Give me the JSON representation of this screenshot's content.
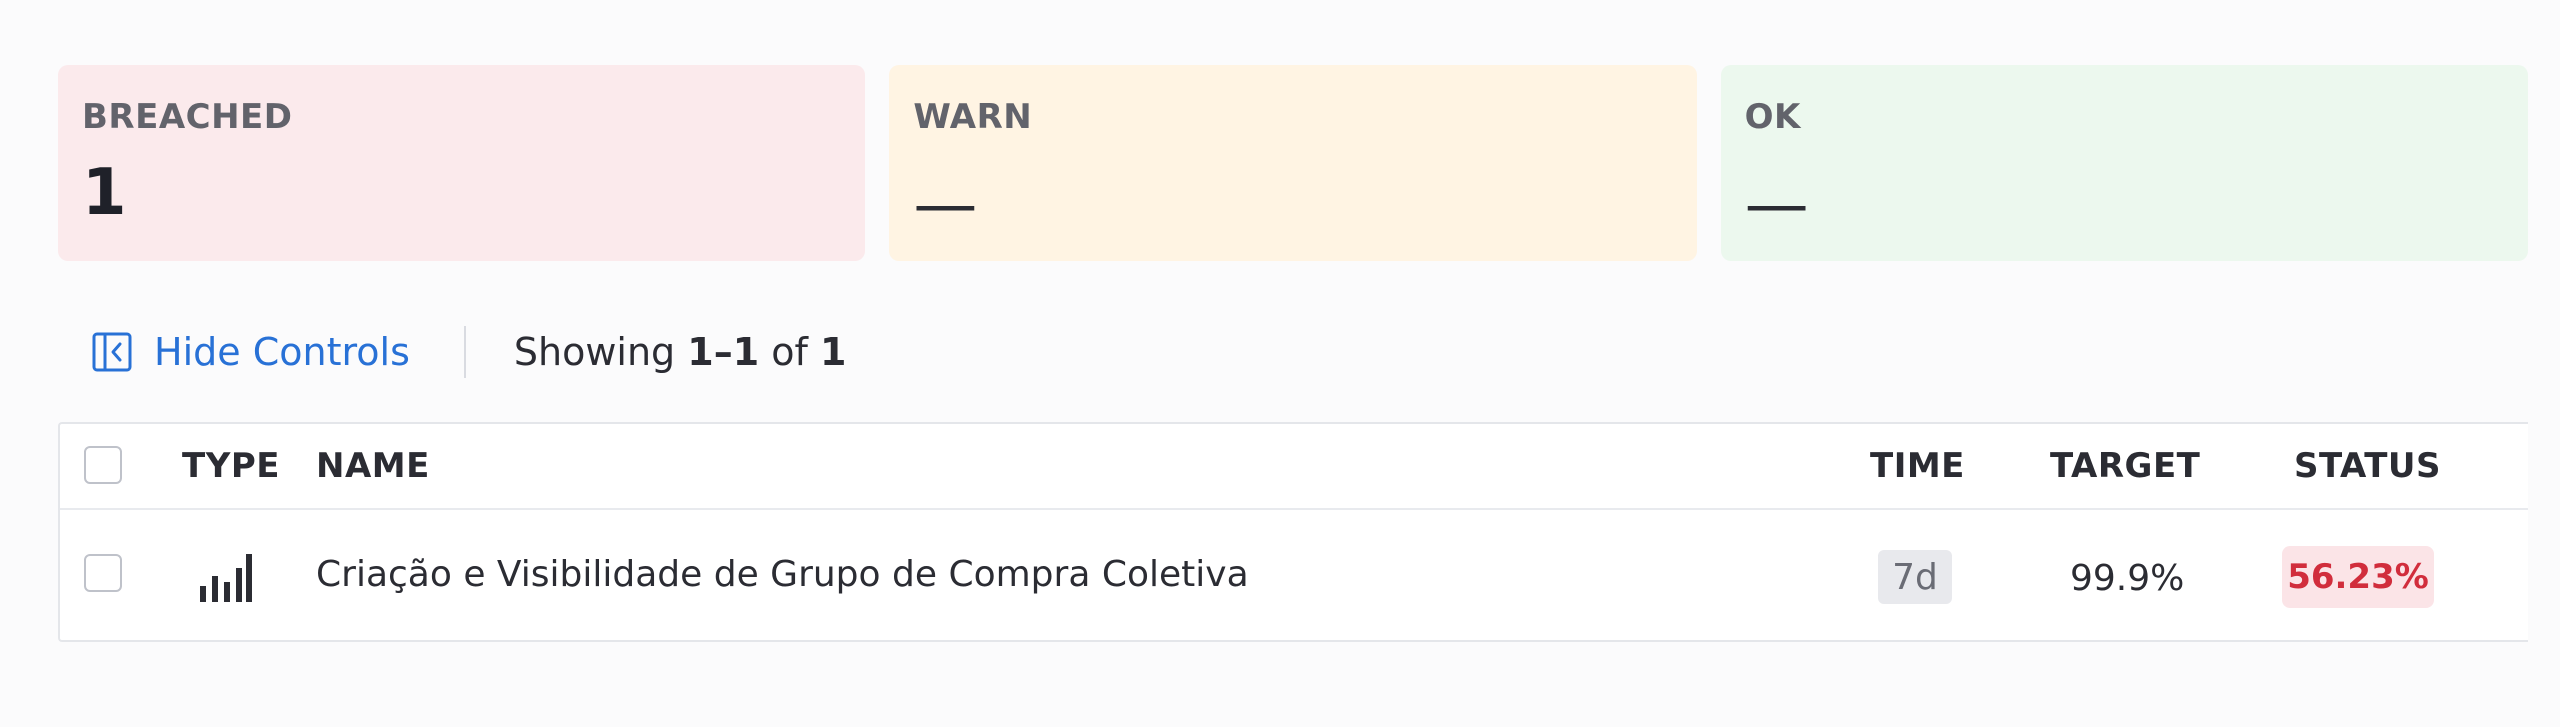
{
  "summary": {
    "breached": {
      "label": "BREACHED",
      "value": "1",
      "color": "#fbeaec"
    },
    "warn": {
      "label": "WARN",
      "value": "—",
      "color": "#fff4e3"
    },
    "ok": {
      "label": "OK",
      "value": "—",
      "color": "#ecf8ee"
    }
  },
  "controls": {
    "hide_label": "Hide Controls",
    "hide_icon": "collapse-panel-icon",
    "showing_prefix": "Showing",
    "showing_range": "1–1",
    "showing_of": "of",
    "showing_total": "1"
  },
  "table": {
    "columns": {
      "type": "TYPE",
      "name": "NAME",
      "time": "TIME",
      "target": "TARGET",
      "status": "STATUS"
    },
    "rows": [
      {
        "type_icon": "bar-chart-icon",
        "name": "Criação e Visibilidade de Grupo de Compra Coletiva",
        "time": "7d",
        "target": "99.9%",
        "status": "56.23%",
        "status_color": "#d12d3c"
      }
    ]
  },
  "colors": {
    "accent": "#2871d6",
    "breached": "#d12d3c"
  }
}
